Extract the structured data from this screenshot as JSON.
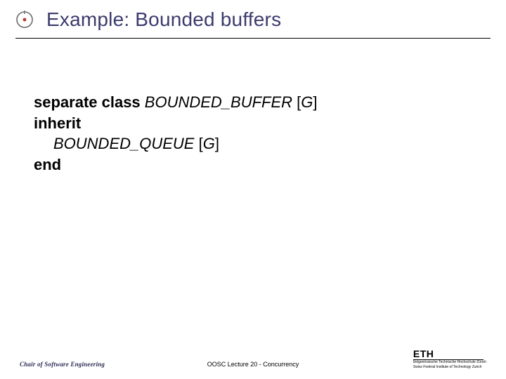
{
  "header": {
    "title": "Example: Bounded buffers"
  },
  "code": {
    "kw_separate_class": "separate class",
    "cls_bb": "BOUNDED_BUFFER",
    "bb_param_open": " [",
    "bb_param_g": "G",
    "bb_param_close": "]",
    "kw_inherit": "inherit",
    "cls_bq": "BOUNDED_QUEUE",
    "bq_param_open": " [",
    "bq_param_g": "G",
    "bq_param_close": "]",
    "kw_end": "end"
  },
  "footer": {
    "left": "Chair of Software Engineering",
    "center": "OOSC  Lecture 20 - Concurrency",
    "eth": "ETH",
    "sub1": "Eidgenössische Technische Hochschule Zürich",
    "sub2": "Swiss Federal Institute of Technology Zurich"
  }
}
